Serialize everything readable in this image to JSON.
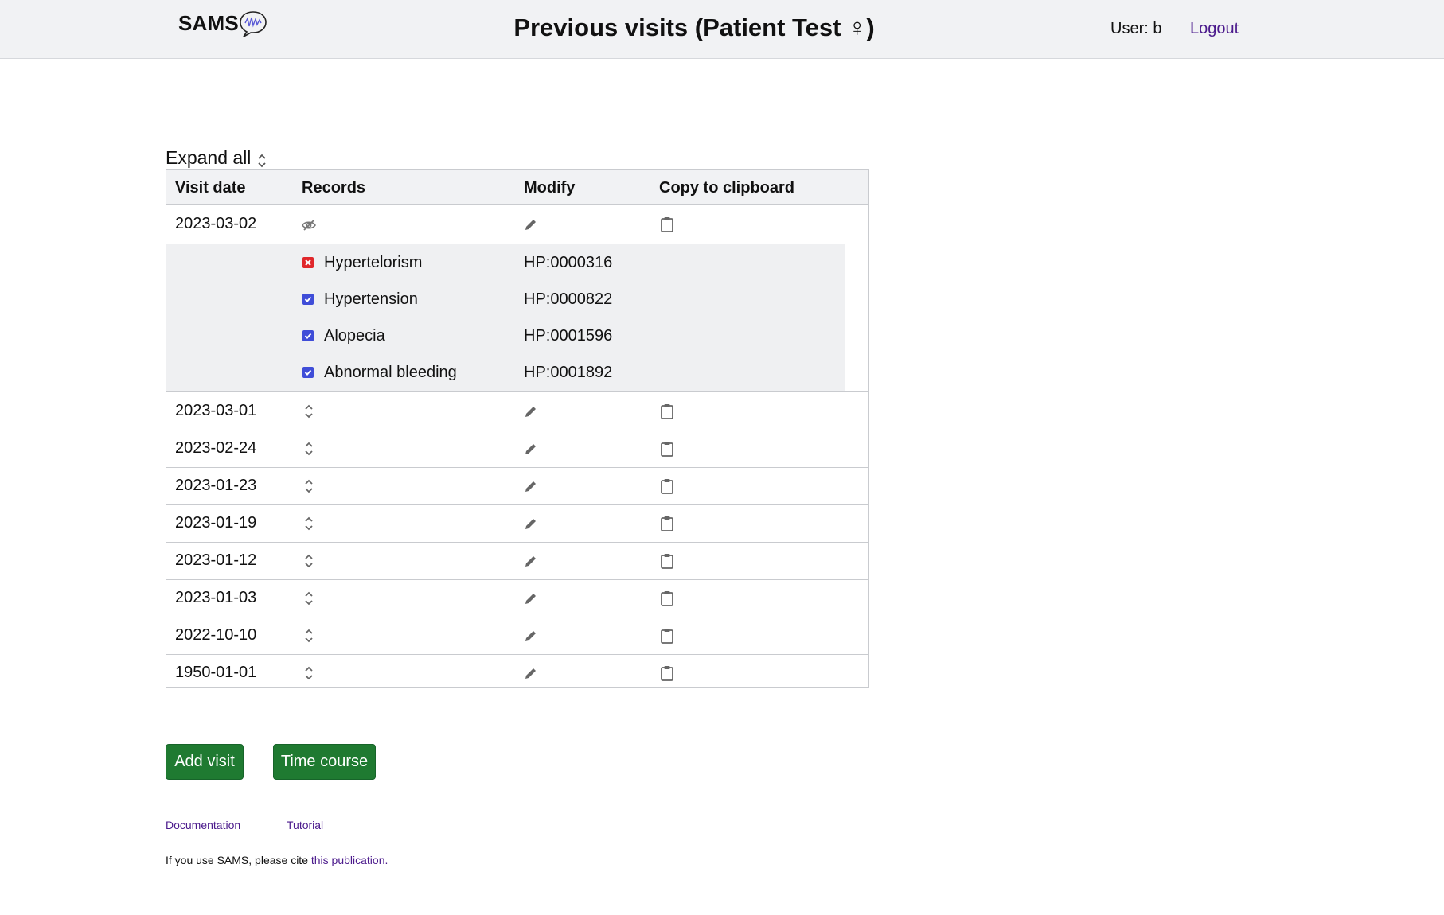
{
  "header": {
    "logo_text": "SAMS",
    "title": "Previous visits (Patient Test ♀)",
    "user": "User: b",
    "logout": "Logout"
  },
  "controls": {
    "expand_all": "Expand all"
  },
  "table": {
    "columns": [
      "Visit date",
      "Records",
      "Modify",
      "Copy to clipboard"
    ],
    "visits": [
      {
        "date": "2023-03-02",
        "expanded": true
      },
      {
        "date": "2023-03-01",
        "expanded": false
      },
      {
        "date": "2023-02-24",
        "expanded": false
      },
      {
        "date": "2023-01-23",
        "expanded": false
      },
      {
        "date": "2023-01-19",
        "expanded": false
      },
      {
        "date": "2023-01-12",
        "expanded": false
      },
      {
        "date": "2023-01-03",
        "expanded": false
      },
      {
        "date": "2022-10-10",
        "expanded": false
      },
      {
        "date": "1950-01-01",
        "expanded": false
      }
    ],
    "expanded_records": [
      {
        "name": "Hypertelorism",
        "hpo": "HP:0000316",
        "status": "excluded"
      },
      {
        "name": "Hypertension",
        "hpo": "HP:0000822",
        "status": "included"
      },
      {
        "name": "Alopecia",
        "hpo": "HP:0001596",
        "status": "included"
      },
      {
        "name": "Abnormal bleeding",
        "hpo": "HP:0001892",
        "status": "included"
      }
    ]
  },
  "buttons": {
    "add_visit": "Add visit",
    "time_course": "Time course"
  },
  "footer": {
    "documentation": "Documentation",
    "tutorial": "Tutorial",
    "cite_prefix": "If you use SAMS, please cite ",
    "cite_link": "this publication."
  },
  "colors": {
    "header_bg": "#f1f2f4",
    "link": "#4b1a8c",
    "button_bg": "#1f7a31",
    "checkbox_included": "#3f4dd8",
    "checkbox_excluded": "#e0272b",
    "expanded_bg": "#eff0f2"
  },
  "icons": {
    "records_collapsed": "chevron-up-down-icon",
    "records_expanded": "eye-slash-icon",
    "modify": "pencil-icon",
    "copy": "clipboard-icon"
  }
}
